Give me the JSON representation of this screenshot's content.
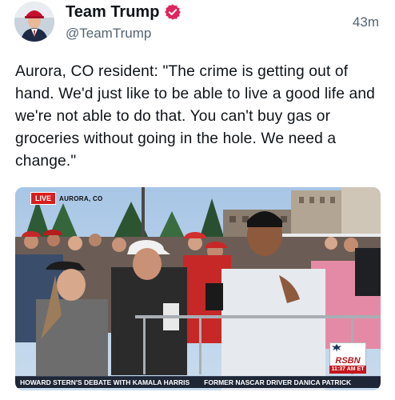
{
  "author": {
    "display_name": "Team Trump",
    "handle": "@TeamTrump",
    "verified": true,
    "avatar_icon": "profile-photo"
  },
  "timestamp": "43m",
  "post": {
    "text": "Aurora, CO resident: \"The crime is getting out of hand. We'd just like to be able to live a good life and we're not able to do that. You can't buy gas or groceries without going in the hole. We need a change.\""
  },
  "media": {
    "live_label": "LIVE",
    "location": "AURORA, CO",
    "network_logo": "RSBN",
    "clock": "11:37 AM ET",
    "ticker": [
      "HOWARD STERN'S DEBATE WITH KAMALA HARRIS",
      "FORMER NASCAR DRIVER DANICA PATRICK"
    ]
  },
  "colors": {
    "verified_badge": "#e0245e",
    "live_red": "#d81e1e",
    "ticker_bg": "#1f2636",
    "secondary_text": "#536471"
  }
}
